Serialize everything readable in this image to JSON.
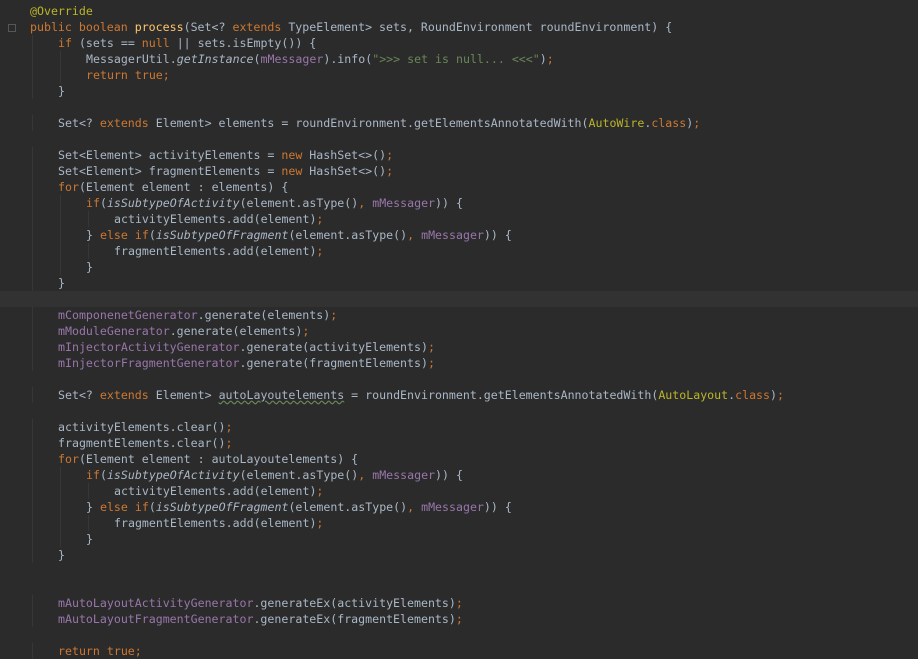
{
  "editor": {
    "lines": [
      {
        "tokens": [
          {
            "t": "@Override",
            "c": "ann"
          }
        ]
      },
      {
        "tokens": [
          {
            "t": "public ",
            "c": "kw"
          },
          {
            "t": "boolean ",
            "c": "kw"
          },
          {
            "t": "process",
            "c": "fn"
          },
          {
            "t": "(Set<? ",
            "c": "plain"
          },
          {
            "t": "extends ",
            "c": "kw"
          },
          {
            "t": "TypeElement> sets, RoundEnvironment roundEnvironment) {",
            "c": "plain"
          }
        ]
      },
      {
        "indent": 1,
        "tokens": [
          {
            "t": "if ",
            "c": "kw"
          },
          {
            "t": "(sets == ",
            "c": "plain"
          },
          {
            "t": "null ",
            "c": "kw"
          },
          {
            "t": "|| sets.isEmpty()) {",
            "c": "plain"
          }
        ]
      },
      {
        "indent": 2,
        "tokens": [
          {
            "t": "MessagerUtil.",
            "c": "plain"
          },
          {
            "t": "getInstance",
            "c": "static"
          },
          {
            "t": "(",
            "c": "plain"
          },
          {
            "t": "mMessager",
            "c": "field"
          },
          {
            "t": ").info(",
            "c": "plain"
          },
          {
            "t": "\">>> set is null... <<<\"",
            "c": "str"
          },
          {
            "t": ")",
            "c": "plain"
          },
          {
            "t": ";",
            "c": "kw"
          }
        ]
      },
      {
        "indent": 2,
        "tokens": [
          {
            "t": "return true",
            "c": "kw"
          },
          {
            "t": ";",
            "c": "kw"
          }
        ]
      },
      {
        "indent": 1,
        "tokens": [
          {
            "t": "}",
            "c": "plain"
          }
        ]
      },
      {
        "tokens": []
      },
      {
        "indent": 1,
        "tokens": [
          {
            "t": "Set<? ",
            "c": "plain"
          },
          {
            "t": "extends ",
            "c": "kw"
          },
          {
            "t": "Element> elements = roundEnvironment.getElementsAnnotatedWith(",
            "c": "plain"
          },
          {
            "t": "AutoWire",
            "c": "ann"
          },
          {
            "t": ".",
            "c": "plain"
          },
          {
            "t": "class",
            "c": "kw"
          },
          {
            "t": ")",
            "c": "plain"
          },
          {
            "t": ";",
            "c": "kw"
          }
        ]
      },
      {
        "tokens": []
      },
      {
        "indent": 1,
        "tokens": [
          {
            "t": "Set<Element> activityElements = ",
            "c": "plain"
          },
          {
            "t": "new ",
            "c": "kw"
          },
          {
            "t": "HashSet<>()",
            "c": "plain"
          },
          {
            "t": ";",
            "c": "kw"
          }
        ]
      },
      {
        "indent": 1,
        "tokens": [
          {
            "t": "Set<Element> fragmentElements = ",
            "c": "plain"
          },
          {
            "t": "new ",
            "c": "kw"
          },
          {
            "t": "HashSet<>()",
            "c": "plain"
          },
          {
            "t": ";",
            "c": "kw"
          }
        ]
      },
      {
        "indent": 1,
        "tokens": [
          {
            "t": "for",
            "c": "kw"
          },
          {
            "t": "(Element element : elements) {",
            "c": "plain"
          }
        ]
      },
      {
        "indent": 2,
        "tokens": [
          {
            "t": "if",
            "c": "kw"
          },
          {
            "t": "(",
            "c": "plain"
          },
          {
            "t": "isSubtypeOfActivity",
            "c": "static"
          },
          {
            "t": "(element.asType()",
            "c": "plain"
          },
          {
            "t": ", ",
            "c": "kw"
          },
          {
            "t": "mMessager",
            "c": "field"
          },
          {
            "t": ")) {",
            "c": "plain"
          }
        ]
      },
      {
        "indent": 3,
        "tokens": [
          {
            "t": "activityElements.add(element)",
            "c": "plain"
          },
          {
            "t": ";",
            "c": "kw"
          }
        ]
      },
      {
        "indent": 2,
        "tokens": [
          {
            "t": "} ",
            "c": "plain"
          },
          {
            "t": "else if",
            "c": "kw"
          },
          {
            "t": "(",
            "c": "plain"
          },
          {
            "t": "isSubtypeOfFragment",
            "c": "static"
          },
          {
            "t": "(element.asType()",
            "c": "plain"
          },
          {
            "t": ", ",
            "c": "kw"
          },
          {
            "t": "mMessager",
            "c": "field"
          },
          {
            "t": ")) {",
            "c": "plain"
          }
        ]
      },
      {
        "indent": 3,
        "tokens": [
          {
            "t": "fragmentElements.add(element)",
            "c": "plain"
          },
          {
            "t": ";",
            "c": "kw"
          }
        ]
      },
      {
        "indent": 2,
        "tokens": [
          {
            "t": "}",
            "c": "plain"
          }
        ]
      },
      {
        "indent": 1,
        "tokens": [
          {
            "t": "}",
            "c": "plain"
          }
        ]
      },
      {
        "current": true,
        "tokens": []
      },
      {
        "indent": 1,
        "tokens": [
          {
            "t": "mComponenetGenerator",
            "c": "field"
          },
          {
            "t": ".generate(elements)",
            "c": "plain"
          },
          {
            "t": ";",
            "c": "kw"
          }
        ]
      },
      {
        "indent": 1,
        "tokens": [
          {
            "t": "mModuleGenerator",
            "c": "field"
          },
          {
            "t": ".generate(elements)",
            "c": "plain"
          },
          {
            "t": ";",
            "c": "kw"
          }
        ]
      },
      {
        "indent": 1,
        "tokens": [
          {
            "t": "mInjectorActivityGenerator",
            "c": "field"
          },
          {
            "t": ".generate(activityElements)",
            "c": "plain"
          },
          {
            "t": ";",
            "c": "kw"
          }
        ]
      },
      {
        "indent": 1,
        "tokens": [
          {
            "t": "mInjectorFragmentGenerator",
            "c": "field"
          },
          {
            "t": ".generate(fragmentElements)",
            "c": "plain"
          },
          {
            "t": ";",
            "c": "kw"
          }
        ]
      },
      {
        "tokens": []
      },
      {
        "indent": 1,
        "tokens": [
          {
            "t": "Set<? ",
            "c": "plain"
          },
          {
            "t": "extends ",
            "c": "kw"
          },
          {
            "t": "Element> ",
            "c": "plain"
          },
          {
            "t": "autoLayoutelements",
            "c": "typo"
          },
          {
            "t": " = roundEnvironment.getElementsAnnotatedWith(",
            "c": "plain"
          },
          {
            "t": "AutoLayout",
            "c": "ann"
          },
          {
            "t": ".",
            "c": "plain"
          },
          {
            "t": "class",
            "c": "kw"
          },
          {
            "t": ")",
            "c": "plain"
          },
          {
            "t": ";",
            "c": "kw"
          }
        ]
      },
      {
        "tokens": []
      },
      {
        "indent": 1,
        "tokens": [
          {
            "t": "activityElements.clear()",
            "c": "plain"
          },
          {
            "t": ";",
            "c": "kw"
          }
        ]
      },
      {
        "indent": 1,
        "tokens": [
          {
            "t": "fragmentElements.clear()",
            "c": "plain"
          },
          {
            "t": ";",
            "c": "kw"
          }
        ]
      },
      {
        "indent": 1,
        "tokens": [
          {
            "t": "for",
            "c": "kw"
          },
          {
            "t": "(Element element : autoLayoutelements) {",
            "c": "plain"
          }
        ]
      },
      {
        "indent": 2,
        "tokens": [
          {
            "t": "if",
            "c": "kw"
          },
          {
            "t": "(",
            "c": "plain"
          },
          {
            "t": "isSubtypeOfActivity",
            "c": "static"
          },
          {
            "t": "(element.asType()",
            "c": "plain"
          },
          {
            "t": ", ",
            "c": "kw"
          },
          {
            "t": "mMessager",
            "c": "field"
          },
          {
            "t": ")) {",
            "c": "plain"
          }
        ]
      },
      {
        "indent": 3,
        "tokens": [
          {
            "t": "activityElements.add(element)",
            "c": "plain"
          },
          {
            "t": ";",
            "c": "kw"
          }
        ]
      },
      {
        "indent": 2,
        "tokens": [
          {
            "t": "} ",
            "c": "plain"
          },
          {
            "t": "else if",
            "c": "kw"
          },
          {
            "t": "(",
            "c": "plain"
          },
          {
            "t": "isSubtypeOfFragment",
            "c": "static"
          },
          {
            "t": "(element.asType()",
            "c": "plain"
          },
          {
            "t": ", ",
            "c": "kw"
          },
          {
            "t": "mMessager",
            "c": "field"
          },
          {
            "t": ")) {",
            "c": "plain"
          }
        ]
      },
      {
        "indent": 3,
        "tokens": [
          {
            "t": "fragmentElements.add(element)",
            "c": "plain"
          },
          {
            "t": ";",
            "c": "kw"
          }
        ]
      },
      {
        "indent": 2,
        "tokens": [
          {
            "t": "}",
            "c": "plain"
          }
        ]
      },
      {
        "indent": 1,
        "tokens": [
          {
            "t": "}",
            "c": "plain"
          }
        ]
      },
      {
        "tokens": []
      },
      {
        "tokens": []
      },
      {
        "indent": 1,
        "tokens": [
          {
            "t": "mAutoLayoutActivityGenerator",
            "c": "field"
          },
          {
            "t": ".generateEx(activityElements)",
            "c": "plain"
          },
          {
            "t": ";",
            "c": "kw"
          }
        ]
      },
      {
        "indent": 1,
        "tokens": [
          {
            "t": "mAutoLayoutFragmentGenerator",
            "c": "field"
          },
          {
            "t": ".generateEx(fragmentElements)",
            "c": "plain"
          },
          {
            "t": ";",
            "c": "kw"
          }
        ]
      },
      {
        "tokens": []
      },
      {
        "indent": 1,
        "tokens": [
          {
            "t": "return true",
            "c": "kw"
          },
          {
            "t": ";",
            "c": "kw"
          }
        ]
      }
    ]
  },
  "colors": {
    "background": "#2b2b2b",
    "current_line": "#323232",
    "keyword": "#cc7832",
    "annotation": "#bbb529",
    "method": "#ffc66d",
    "string": "#6a8759",
    "field": "#9876aa",
    "text": "#a9b7c6"
  }
}
